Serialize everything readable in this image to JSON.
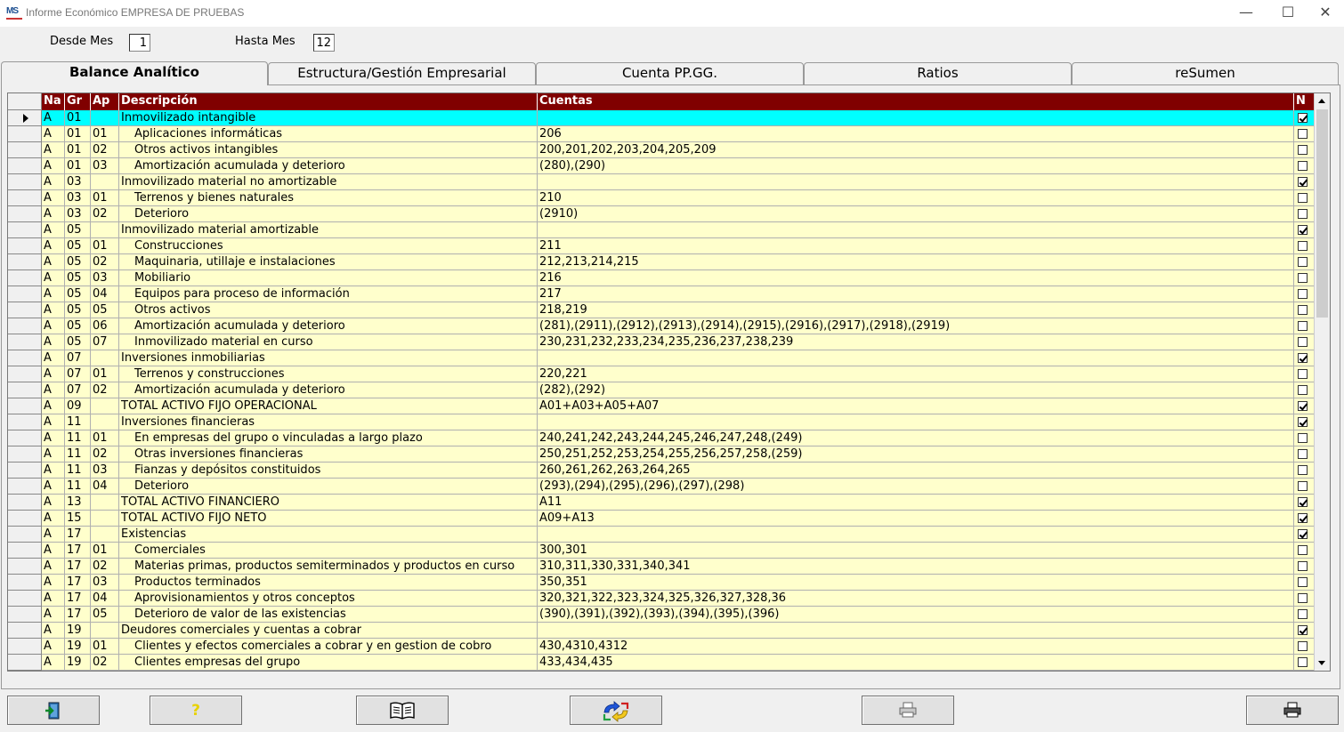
{
  "window": {
    "app_icon": "MS",
    "title": "Informe Económico EMPRESA DE PRUEBAS",
    "minimize_glyph": "—",
    "maximize_glyph": "☐",
    "close_glyph": "✕"
  },
  "range": {
    "from_label": "Desde Mes",
    "from_value": "1",
    "to_label": "Hasta Mes",
    "to_value": "12"
  },
  "tabs": [
    {
      "label": "Balance Analítico",
      "active": true
    },
    {
      "label": "Estructura/Gestión Empresarial",
      "active": false
    },
    {
      "label": "Cuenta PP.GG.",
      "active": false
    },
    {
      "label": "Ratios",
      "active": false
    },
    {
      "label": "reSumen",
      "active": false
    }
  ],
  "grid": {
    "headers": {
      "na": "Na",
      "gr": "Gr",
      "ap": "Ap",
      "desc": "Descripción",
      "cuentas": "Cuentas",
      "n": "N"
    },
    "rows": [
      {
        "na": "A",
        "gr": "01",
        "ap": "",
        "desc": "Inmovilizado intangible",
        "cuentas": "",
        "n": true,
        "selected": true
      },
      {
        "na": "A",
        "gr": "01",
        "ap": "01",
        "desc": "Aplicaciones informáticas",
        "cuentas": "206",
        "n": false
      },
      {
        "na": "A",
        "gr": "01",
        "ap": "02",
        "desc": "Otros activos intangibles",
        "cuentas": "200,201,202,203,204,205,209",
        "n": false
      },
      {
        "na": "A",
        "gr": "01",
        "ap": "03",
        "desc": "Amortización acumulada y deterioro",
        "cuentas": "(280),(290)",
        "n": false
      },
      {
        "na": "A",
        "gr": "03",
        "ap": "",
        "desc": "Inmovilizado material no amortizable",
        "cuentas": "",
        "n": true
      },
      {
        "na": "A",
        "gr": "03",
        "ap": "01",
        "desc": "Terrenos y bienes naturales",
        "cuentas": "210",
        "n": false
      },
      {
        "na": "A",
        "gr": "03",
        "ap": "02",
        "desc": "Deterioro",
        "cuentas": "(2910)",
        "n": false
      },
      {
        "na": "A",
        "gr": "05",
        "ap": "",
        "desc": "Inmovilizado material amortizable",
        "cuentas": "",
        "n": true
      },
      {
        "na": "A",
        "gr": "05",
        "ap": "01",
        "desc": "Construcciones",
        "cuentas": "211",
        "n": false
      },
      {
        "na": "A",
        "gr": "05",
        "ap": "02",
        "desc": "Maquinaria, utillaje e instalaciones",
        "cuentas": "212,213,214,215",
        "n": false
      },
      {
        "na": "A",
        "gr": "05",
        "ap": "03",
        "desc": "Mobiliario",
        "cuentas": "216",
        "n": false
      },
      {
        "na": "A",
        "gr": "05",
        "ap": "04",
        "desc": "Equipos para proceso de información",
        "cuentas": "217",
        "n": false
      },
      {
        "na": "A",
        "gr": "05",
        "ap": "05",
        "desc": "Otros activos",
        "cuentas": "218,219",
        "n": false
      },
      {
        "na": "A",
        "gr": "05",
        "ap": "06",
        "desc": "Amortización acumulada y deterioro",
        "cuentas": "(281),(2911),(2912),(2913),(2914),(2915),(2916),(2917),(2918),(2919)",
        "n": false
      },
      {
        "na": "A",
        "gr": "05",
        "ap": "07",
        "desc": "Inmovilizado material en curso",
        "cuentas": "230,231,232,233,234,235,236,237,238,239",
        "n": false
      },
      {
        "na": "A",
        "gr": "07",
        "ap": "",
        "desc": "Inversiones inmobiliarias",
        "cuentas": "",
        "n": true
      },
      {
        "na": "A",
        "gr": "07",
        "ap": "01",
        "desc": "Terrenos y construcciones",
        "cuentas": "220,221",
        "n": false
      },
      {
        "na": "A",
        "gr": "07",
        "ap": "02",
        "desc": "Amortización acumulada y deterioro",
        "cuentas": "(282),(292)",
        "n": false
      },
      {
        "na": "A",
        "gr": "09",
        "ap": "",
        "desc": "TOTAL ACTIVO FIJO OPERACIONAL",
        "cuentas": "A01+A03+A05+A07",
        "n": true
      },
      {
        "na": "A",
        "gr": "11",
        "ap": "",
        "desc": "Inversiones financieras",
        "cuentas": "",
        "n": true
      },
      {
        "na": "A",
        "gr": "11",
        "ap": "01",
        "desc": "En empresas del grupo o vinculadas a largo plazo",
        "cuentas": "240,241,242,243,244,245,246,247,248,(249)",
        "n": false
      },
      {
        "na": "A",
        "gr": "11",
        "ap": "02",
        "desc": "Otras inversiones financieras",
        "cuentas": "250,251,252,253,254,255,256,257,258,(259)",
        "n": false
      },
      {
        "na": "A",
        "gr": "11",
        "ap": "03",
        "desc": "Fianzas y depósitos constituidos",
        "cuentas": "260,261,262,263,264,265",
        "n": false
      },
      {
        "na": "A",
        "gr": "11",
        "ap": "04",
        "desc": "Deterioro",
        "cuentas": "(293),(294),(295),(296),(297),(298)",
        "n": false
      },
      {
        "na": "A",
        "gr": "13",
        "ap": "",
        "desc": "TOTAL ACTIVO FINANCIERO",
        "cuentas": "A11",
        "n": true
      },
      {
        "na": "A",
        "gr": "15",
        "ap": "",
        "desc": "TOTAL ACTIVO FIJO NETO",
        "cuentas": "A09+A13",
        "n": true
      },
      {
        "na": "A",
        "gr": "17",
        "ap": "",
        "desc": "Existencias",
        "cuentas": "",
        "n": true
      },
      {
        "na": "A",
        "gr": "17",
        "ap": "01",
        "desc": "Comerciales",
        "cuentas": "300,301",
        "n": false
      },
      {
        "na": "A",
        "gr": "17",
        "ap": "02",
        "desc": "Materias primas, productos semiterminados y productos en curso",
        "cuentas": "310,311,330,331,340,341",
        "n": false
      },
      {
        "na": "A",
        "gr": "17",
        "ap": "03",
        "desc": "Productos terminados",
        "cuentas": "350,351",
        "n": false
      },
      {
        "na": "A",
        "gr": "17",
        "ap": "04",
        "desc": "Aprovisionamientos y otros conceptos",
        "cuentas": "320,321,322,323,324,325,326,327,328,36",
        "n": false
      },
      {
        "na": "A",
        "gr": "17",
        "ap": "05",
        "desc": "Deterioro de valor de las existencias",
        "cuentas": "(390),(391),(392),(393),(394),(395),(396)",
        "n": false
      },
      {
        "na": "A",
        "gr": "19",
        "ap": "",
        "desc": "Deudores comerciales y cuentas a cobrar",
        "cuentas": "",
        "n": true
      },
      {
        "na": "A",
        "gr": "19",
        "ap": "01",
        "desc": "Clientes y efectos comerciales a cobrar y en gestion de cobro",
        "cuentas": "430,4310,4312",
        "n": false
      },
      {
        "na": "A",
        "gr": "19",
        "ap": "02",
        "desc": "Clientes empresas del grupo",
        "cuentas": "433,434,435",
        "n": false
      }
    ]
  },
  "toolbar": {
    "buttons": [
      {
        "name": "exit-button",
        "icon": "exit-door-icon"
      },
      {
        "name": "help-button",
        "icon": "help-icon",
        "glyph": "?"
      },
      {
        "name": "book-button",
        "icon": "book-icon"
      },
      {
        "name": "refresh-button",
        "icon": "refresh-arrows-icon"
      },
      {
        "name": "print-preview-button",
        "icon": "printer-icon"
      },
      {
        "name": "print-button",
        "icon": "printer-icon"
      }
    ]
  },
  "colors": {
    "header_bg": "#800000",
    "row_bg": "#ffffcc",
    "selected_bg": "#00ffff"
  }
}
